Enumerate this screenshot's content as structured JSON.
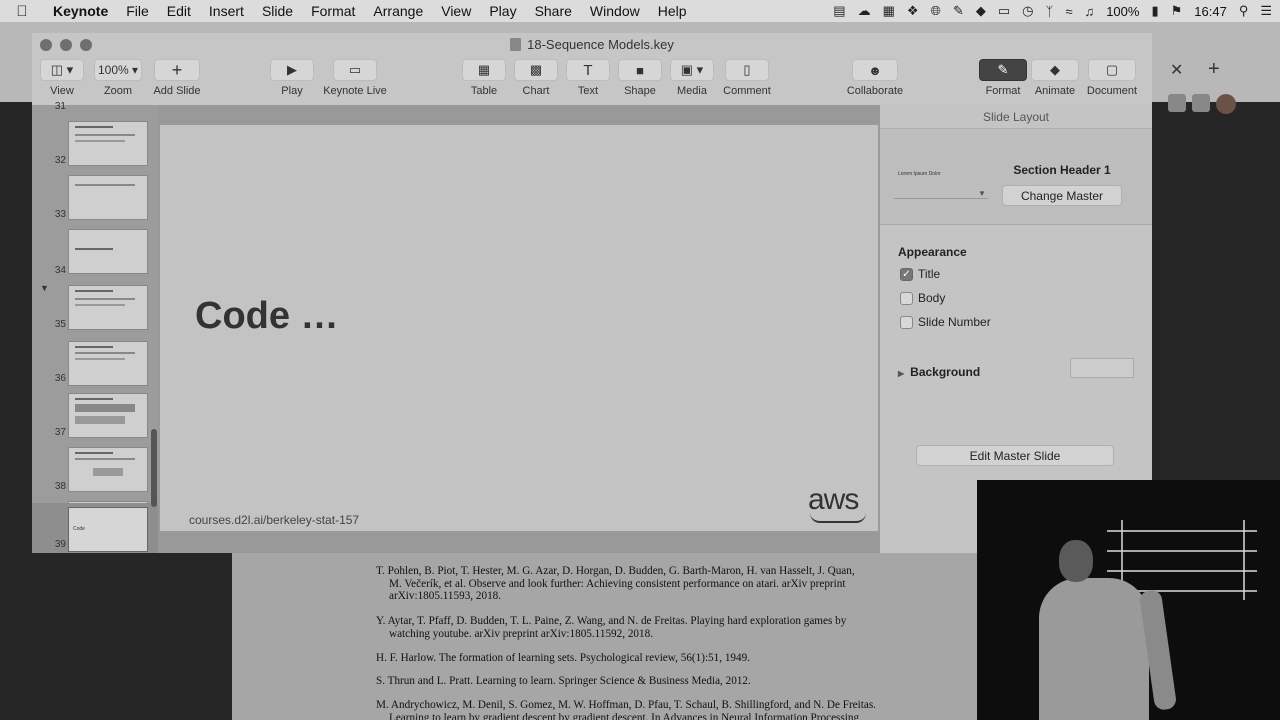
{
  "menubar": {
    "apple_icon": "apple-icon",
    "items": [
      "Keynote",
      "File",
      "Edit",
      "Insert",
      "Slide",
      "Format",
      "Arrange",
      "View",
      "Play",
      "Share",
      "Window",
      "Help"
    ],
    "battery": "100%",
    "time": "16:47"
  },
  "window": {
    "title": "18-Sequence Models.key"
  },
  "toolbar": {
    "view": "View",
    "zoom": "Zoom",
    "zoom_value": "100%",
    "add_slide": "Add Slide",
    "play": "Play",
    "keynote_live": "Keynote Live",
    "table": "Table",
    "chart": "Chart",
    "text": "Text",
    "shape": "Shape",
    "media": "Media",
    "comment": "Comment",
    "collaborate": "Collaborate",
    "format": "Format",
    "animate": "Animate",
    "document": "Document"
  },
  "navigator": {
    "slides": [
      {
        "num": "31",
        "text": ""
      },
      {
        "num": "32",
        "text": ""
      },
      {
        "num": "33",
        "text": ""
      },
      {
        "num": "34",
        "text": ""
      },
      {
        "num": "35",
        "text": ""
      },
      {
        "num": "36",
        "text": ""
      },
      {
        "num": "37",
        "text": ""
      },
      {
        "num": "38",
        "text": ""
      },
      {
        "num": "39",
        "text": "Code"
      }
    ]
  },
  "slide": {
    "title": "Code …",
    "footer": "courses.d2l.ai/berkeley-stat-157",
    "logo": "aws"
  },
  "inspector": {
    "header": "Slide Layout",
    "master_thumb_text": "Lorem Ipsum Dolor",
    "master_name": "Section Header 1",
    "change_master": "Change Master",
    "appearance": "Appearance",
    "checkboxes": [
      {
        "label": "Title",
        "checked": true
      },
      {
        "label": "Body",
        "checked": false
      },
      {
        "label": "Slide Number",
        "checked": false
      }
    ],
    "background": "Background",
    "edit_master": "Edit Master Slide"
  },
  "paper": {
    "refs": [
      {
        "line1": "T. Pohlen, B. Piot, T. Hester, M. G. Azar, D. Horgan, D. Budden, G. Barth-Maron, H. van Hasselt, J. Quan,",
        "line2": "M. Večerík, et al. Observe and look further: Achieving consistent performance on atari. arXiv preprint",
        "line3": "arXiv:1805.11593, 2018."
      },
      {
        "line1": "Y. Aytar, T. Pfaff, D. Budden, T. L. Paine, Z. Wang, and N. de Freitas. Playing hard exploration games by",
        "line2": "watching youtube. arXiv preprint arXiv:1805.11592, 2018."
      },
      {
        "line1": "H. F. Harlow. The formation of learning sets. Psychological review, 56(1):51, 1949."
      },
      {
        "line1": "S. Thrun and L. Pratt. Learning to learn. Springer Science & Business Media, 2012."
      },
      {
        "line1": "M. Andrychowicz, M. Denil, S. Gomez, M. W. Hoffman, D. Pfau, T. Schaul, B. Shillingford, and N. De Freitas.",
        "line2": "Learning to learn by gradient descent by gradient descent. In Advances in Neural Information Processing"
      }
    ]
  }
}
